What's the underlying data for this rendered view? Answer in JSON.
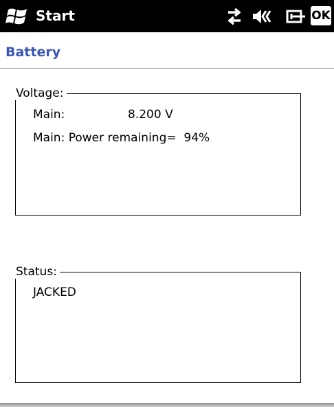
{
  "taskbar": {
    "start_label": "Start",
    "ok_label": "OK",
    "icons": [
      "windows-logo-icon",
      "network-sync-icon",
      "speaker-muted-icon",
      "power-plug-icon"
    ]
  },
  "window": {
    "title": "Battery"
  },
  "voltage_group": {
    "legend": "Voltage:",
    "main_label": "Main:",
    "main_value": "8.200 V",
    "remaining_text": "Main: Power remaining=  94%"
  },
  "status_group": {
    "legend": "Status:",
    "value": "JACKED"
  }
}
